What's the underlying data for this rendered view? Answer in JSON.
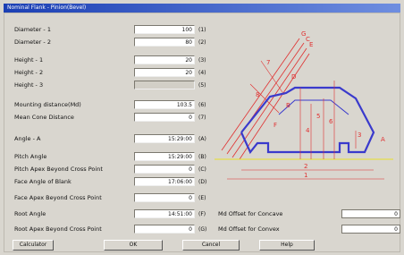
{
  "window": {
    "title": "Nominal Flank - Pinion(Bevel)"
  },
  "fields": [
    {
      "label": "Diameter - 1",
      "value": "100",
      "code": "(1)"
    },
    {
      "label": "Diameter - 2",
      "value": "80",
      "code": "(2)"
    },
    {
      "label": "Height - 1",
      "value": "20",
      "code": "(3)"
    },
    {
      "label": "Height - 2",
      "value": "20",
      "code": "(4)"
    },
    {
      "label": "Height - 3",
      "value": "",
      "code": "(5)"
    },
    {
      "label": "Mounting distance(Md)",
      "value": "103.5",
      "code": "(6)"
    },
    {
      "label": "Mean Cone Distance",
      "value": "0",
      "code": "(7)"
    },
    {
      "label": "Angle - A",
      "value": "15:29:00",
      "code": "(A)"
    },
    {
      "label": "Pitch Angle",
      "value": "15:29:00",
      "code": "(B)"
    },
    {
      "label": "Pitch Apex Beyond Cross Point",
      "value": "0",
      "code": "(C)"
    },
    {
      "label": "Face Angle of Blank",
      "value": "17:06:00",
      "code": "(D)"
    },
    {
      "label": "Face Apex Beyond Cross Point",
      "value": "0",
      "code": "(E)"
    },
    {
      "label": "Root Angle",
      "value": "14:51:00",
      "code": "(F)"
    },
    {
      "label": "Root Apex Beyond Cross Point",
      "value": "0",
      "code": "(G)"
    }
  ],
  "offsets": [
    {
      "label": "Md Offset for Concave",
      "value": "0"
    },
    {
      "label": "Md Offset for Convex",
      "value": "0"
    }
  ],
  "diagram": {
    "letters": [
      "G",
      "C",
      "E",
      "D",
      "7",
      "8",
      "F",
      "B",
      "4",
      "5",
      "6",
      "3",
      "A",
      "2",
      "1"
    ]
  },
  "buttons": {
    "calculator": "Calculator",
    "ok": "OK",
    "cancel": "Cancel",
    "help": "Help"
  }
}
